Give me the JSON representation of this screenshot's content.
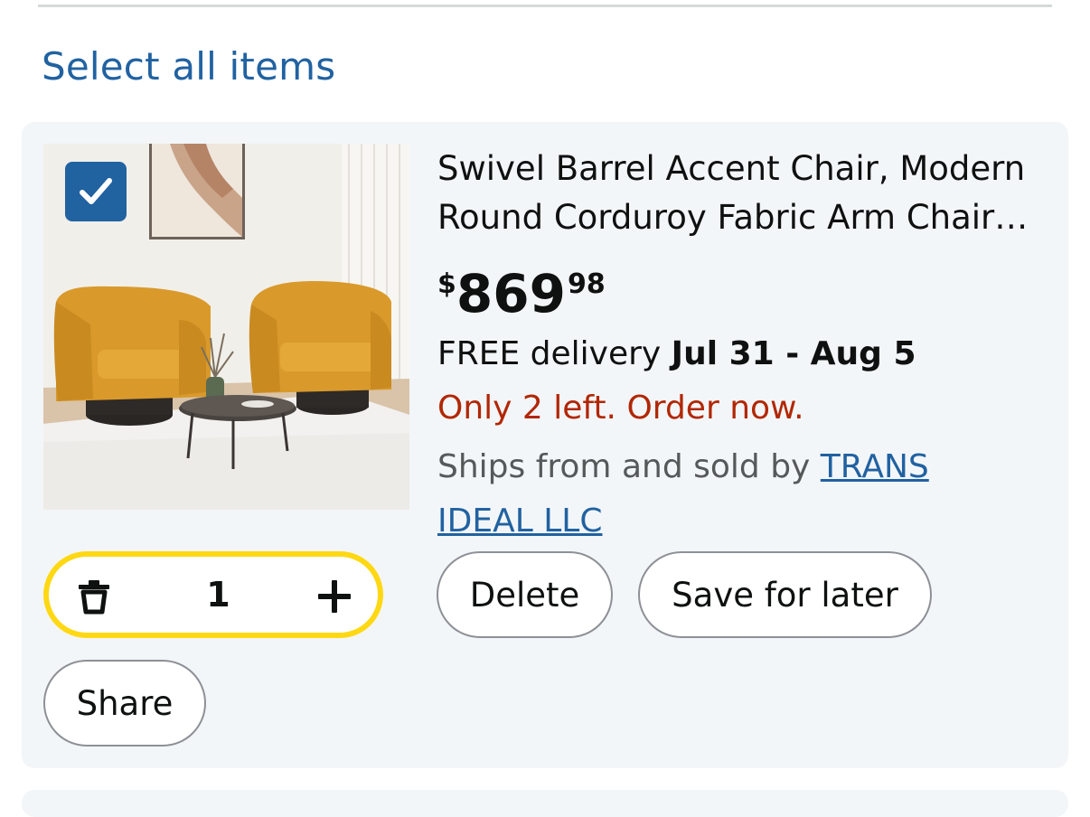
{
  "header": {
    "select_all": "Select all items"
  },
  "item": {
    "checkbox_checked": true,
    "title_line1": "Swivel Barrel Accent Chair, Modern",
    "title_line2": "Round Corduroy Fabric Arm Chair…",
    "price": {
      "symbol": "$",
      "whole": "869",
      "fraction": "98"
    },
    "delivery": {
      "prefix": "FREE delivery ",
      "dates": "Jul 31 - Aug 5"
    },
    "stock": "Only 2 left. Order now.",
    "ships": {
      "prefix": "Ships from and sold by ",
      "seller": "TRANS IDEAL LLC"
    },
    "quantity": "1",
    "actions": {
      "delete": "Delete",
      "save_for_later": "Save for later",
      "share": "Share"
    }
  },
  "icons": {
    "checkbox": "checkmark-icon",
    "decrement": "trash-icon",
    "increment": "plus-icon"
  },
  "colors": {
    "link": "#2162a1",
    "stock_warning": "#b12704",
    "quantity_border": "#ffd814",
    "card_bg": "#f3f6f8",
    "checkbox_bg": "#2162a1"
  }
}
